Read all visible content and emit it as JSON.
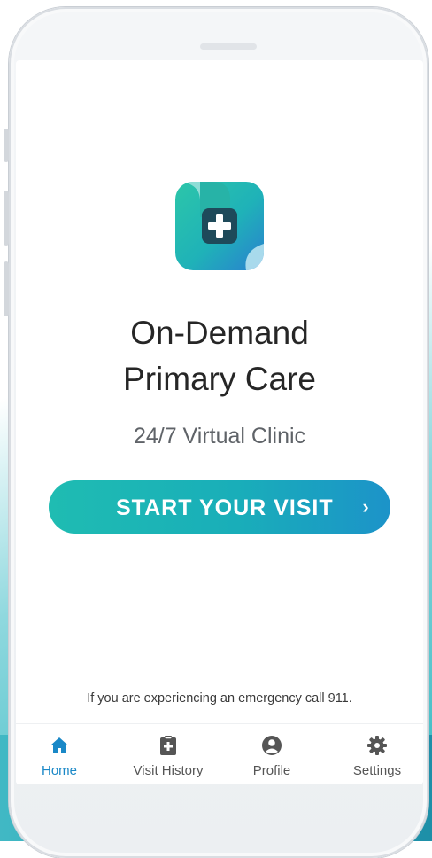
{
  "app": {
    "title_line1": "On-Demand",
    "title_line2": "Primary Care",
    "subtitle": "24/7 Virtual Clinic"
  },
  "cta": {
    "label": "START YOUR VISIT",
    "arrow": "›"
  },
  "footer_note": "If you are experiencing an emergency call 911.",
  "nav": {
    "items": [
      {
        "label": "Home",
        "icon": "home-icon",
        "active": true
      },
      {
        "label": "Visit History",
        "icon": "clipboard-plus-icon",
        "active": false
      },
      {
        "label": "Profile",
        "icon": "user-circle-icon",
        "active": false
      },
      {
        "label": "Settings",
        "icon": "gear-icon",
        "active": false
      }
    ]
  },
  "colors": {
    "accent": "#1a88c7",
    "button_start": "#1fbcb2",
    "button_end": "#1c93c9",
    "nav_icon": "#555555"
  }
}
